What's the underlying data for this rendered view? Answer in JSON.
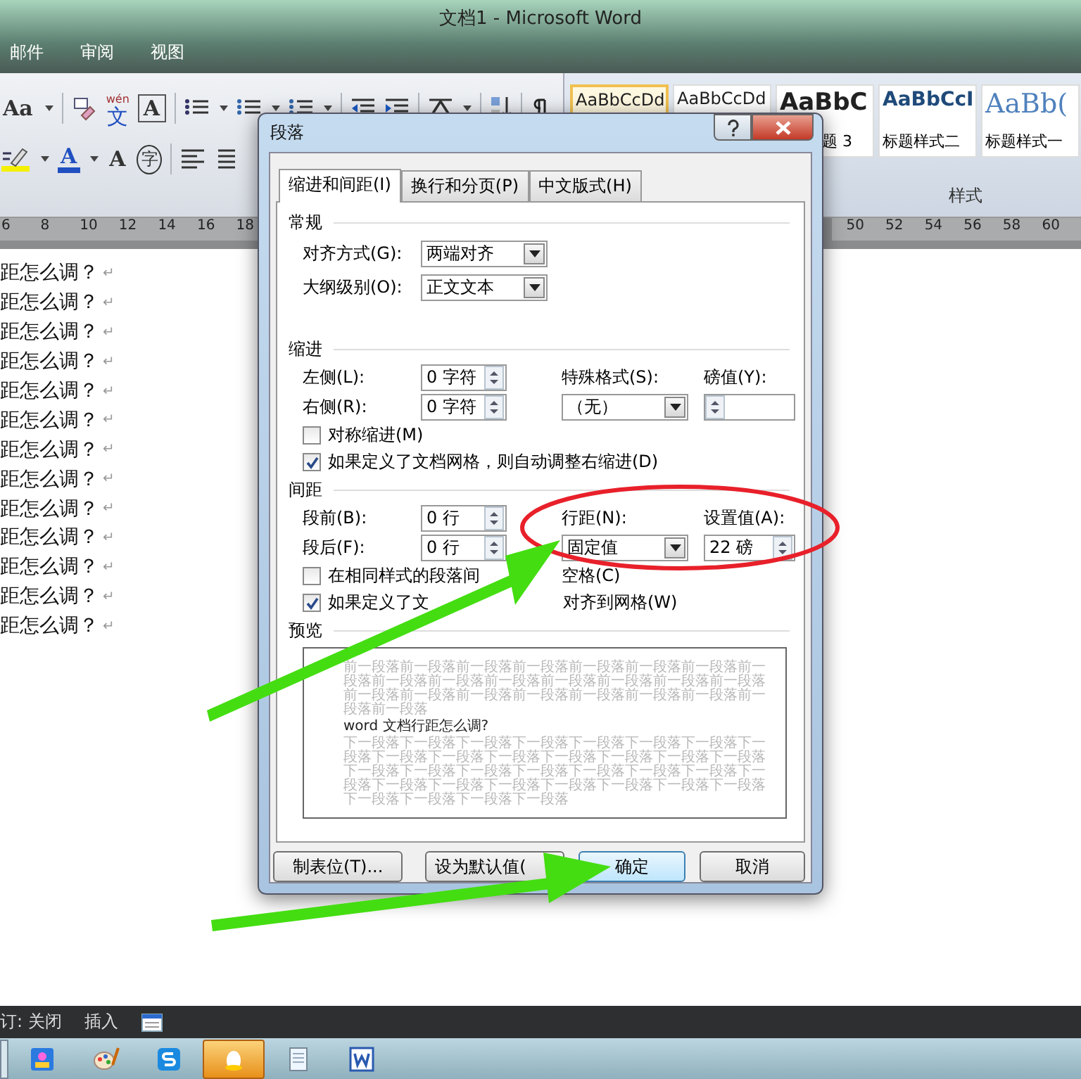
{
  "window": {
    "title": "文档1 - Microsoft Word"
  },
  "menu_tabs": [
    "邮件",
    "审阅",
    "视图"
  ],
  "ribbon": {
    "change_case": "Aa",
    "phonetic": {
      "top": "wén",
      "char": "文"
    },
    "char_border": "A",
    "font_color": "A",
    "char_shading": "A",
    "enclose": "字",
    "styles": [
      {
        "preview": "AaBbCcDd",
        "selected": true
      },
      {
        "preview": "AaBbCcDd",
        "selected": false
      },
      {
        "preview": "AaBbC",
        "label": "题 3",
        "selected": false
      },
      {
        "preview": "AaBbCcI",
        "label": "标题样式二",
        "selected": false
      },
      {
        "preview": "AaBb(",
        "label": "标题样式一",
        "selected": false
      }
    ],
    "styles_group_label": "样式"
  },
  "ruler": {
    "left_numbers": [
      "6",
      "8",
      "10",
      "12",
      "14",
      "16",
      "18"
    ],
    "right_numbers": [
      "50",
      "52",
      "54",
      "56",
      "58",
      "60"
    ]
  },
  "document": {
    "lines": [
      {
        "text": "距怎么调？",
        "mark": "↵"
      },
      {
        "text": "距怎么调？",
        "mark": "↵"
      },
      {
        "text": "距怎么调？",
        "mark": "↵"
      },
      {
        "text": "距怎么调？",
        "mark": "↵"
      },
      {
        "text": "距怎么调？",
        "mark": "↵"
      },
      {
        "text": "距怎么调？",
        "mark": "↵"
      },
      {
        "text": "距怎么调？",
        "mark": "↵"
      },
      {
        "text": "距怎么调？",
        "mark": "↵"
      },
      {
        "text": "距怎么调？",
        "mark": "↵"
      },
      {
        "text": "距怎么调？",
        "mark": "↵"
      },
      {
        "text": "距怎么调？",
        "mark": "↵"
      },
      {
        "text": "距怎么调？",
        "mark": "↵"
      },
      {
        "text": "距怎么调？",
        "mark": "↵"
      }
    ]
  },
  "status_bar": {
    "items": [
      "订: 关闭",
      "插入"
    ]
  },
  "taskbar": {
    "apps": [
      {
        "active": false
      },
      {
        "active": false
      },
      {
        "active": false
      },
      {
        "active": true
      },
      {
        "active": false
      },
      {
        "active": false
      }
    ]
  },
  "dialog": {
    "title": "段落",
    "tabs": [
      {
        "label": "缩进和间距(I)",
        "selected": true
      },
      {
        "label": "换行和分页(P)",
        "selected": false
      },
      {
        "label": "中文版式(H)",
        "selected": false
      }
    ],
    "general": {
      "heading": "常规",
      "alignment": {
        "label": "对齐方式(G):",
        "value": "两端对齐"
      },
      "outline_level": {
        "label": "大纲级别(O):",
        "value": "正文文本"
      }
    },
    "indentation": {
      "heading": "缩进",
      "left": {
        "label": "左侧(L):",
        "value": "0 字符"
      },
      "right": {
        "label": "右侧(R):",
        "value": "0 字符"
      },
      "special": {
        "label": "特殊格式(S):",
        "value": "（无）"
      },
      "by": {
        "label": "磅值(Y):"
      },
      "checkboxes": [
        {
          "label": "对称缩进(M)",
          "checked": false
        },
        {
          "label": "如果定义了文档网格，则自动调整右缩进(D)",
          "checked": true
        }
      ]
    },
    "spacing": {
      "heading": "间距",
      "before": {
        "label": "段前(B):",
        "value": "0 行"
      },
      "after": {
        "label": "段后(F):",
        "value": "0 行"
      },
      "line_spacing": {
        "label": "行距(N):",
        "value": "固定值"
      },
      "at": {
        "label": "设置值(A):",
        "value": "22 磅"
      },
      "checkboxes": [
        {
          "label": "在相同样式的段落间",
          "label_end": "空格(C)",
          "checked": false
        },
        {
          "label": "如果定义了文",
          "label_end": "对齐到网格(W)",
          "checked": true
        }
      ]
    },
    "preview": {
      "heading": "预览",
      "previous": "前一段落前一段落前一段落前一段落前一段落前一段落前一段落前一段落前一段落前一段落前一段落前一段落前一段落前一段落前一段落前一段落前一段落前一段落前一段落前一段落前一段落前一段落前一段落前一段落",
      "sample": "word 文档行距怎么调?",
      "next": "下一段落下一段落下一段落下一段落下一段落下一段落下一段落下一段落下一段落下一段落下一段落下一段落下一段落下一段落下一段落下一段落下一段落下一段落下一段落下一段落下一段落下一段落下一段落下一段落下一段落下一段落下一段落下一段落下一段落下一段落下一段落下一段落下一段落下一段落"
    },
    "buttons": [
      {
        "label": "制表位(T)...",
        "default": false
      },
      {
        "label": "设为默认值(",
        "default": false
      },
      {
        "label": "确定",
        "default": true
      },
      {
        "label": "取消",
        "default": false
      }
    ]
  }
}
